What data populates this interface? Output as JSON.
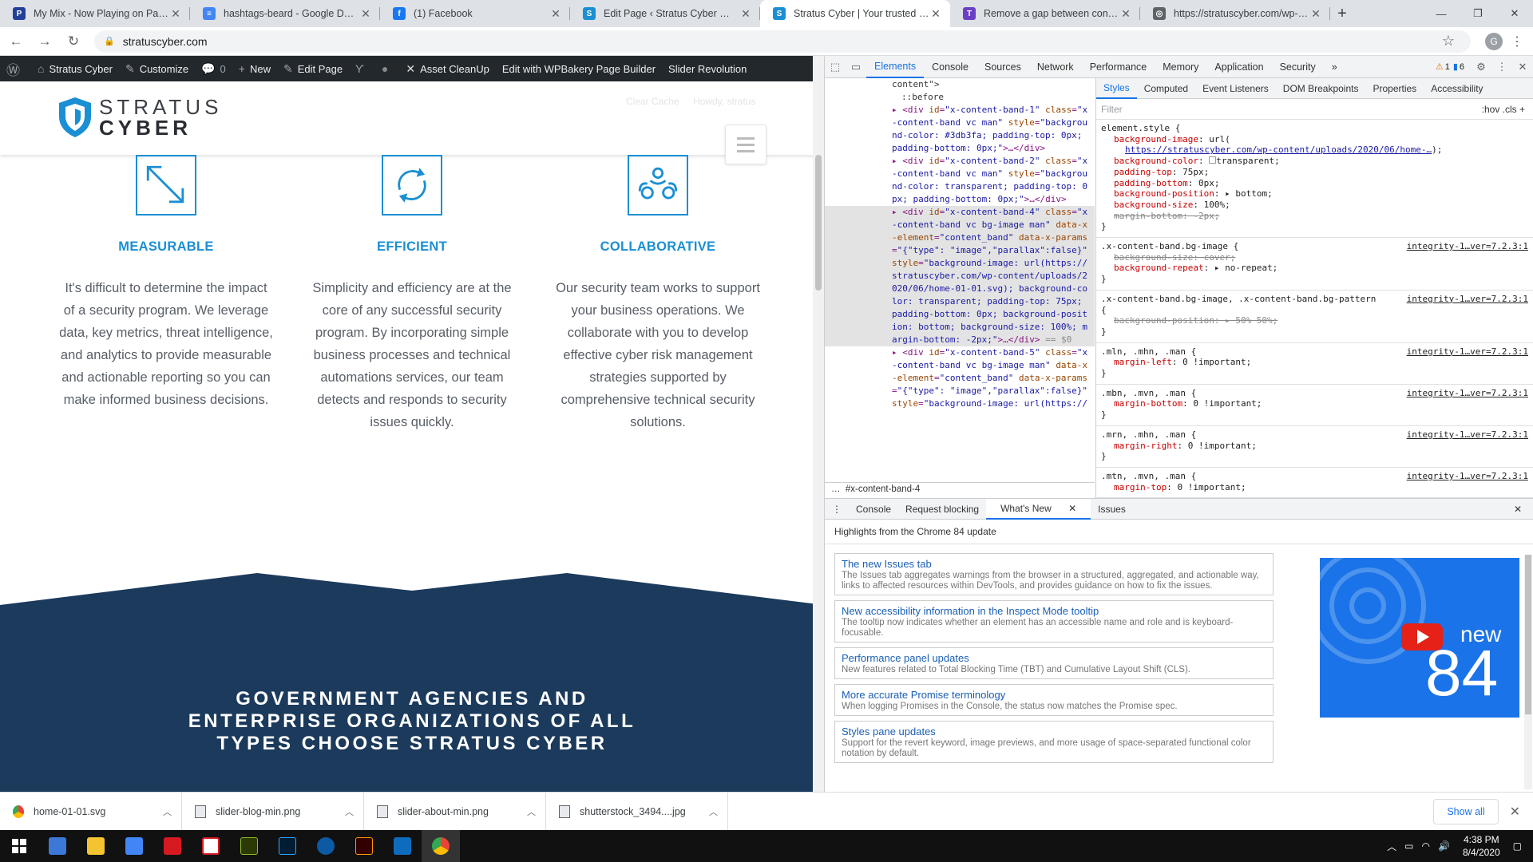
{
  "browser": {
    "tabs": [
      {
        "title": "My Mix - Now Playing on Pandora",
        "favicon_color": "#224099",
        "favicon_letter": "P"
      },
      {
        "title": "hashtags-beard - Google Docs",
        "favicon_color": "#4285f4",
        "favicon_letter": "≡"
      },
      {
        "title": "(1) Facebook",
        "favicon_color": "#1877f2",
        "favicon_letter": "f"
      },
      {
        "title": "Edit Page ‹ Stratus Cyber — WordPress",
        "favicon_color": "#1b8fd3",
        "favicon_letter": "S"
      },
      {
        "title": "Stratus Cyber | Your trusted enterprise",
        "favicon_color": "#1b8fd3",
        "favicon_letter": "S"
      },
      {
        "title": "Remove a gap between content band",
        "favicon_color": "#6a3fc6",
        "favicon_letter": "T"
      },
      {
        "title": "https://stratuscyber.com/wp-content",
        "favicon_color": "#5f6368",
        "favicon_letter": "◎"
      }
    ],
    "active_tab_index": 4,
    "url": "stratuscyber.com",
    "profile_letter": "G"
  },
  "wp_admin_bar": {
    "items": [
      "Stratus Cyber",
      "Customize",
      "0",
      "New",
      "Edit Page",
      "Asset CleanUp",
      "Edit with WPBakery Page Builder",
      "Slider Revolution"
    ],
    "ghost_links": [
      "Clear Cache",
      "Howdy, stratus"
    ]
  },
  "site": {
    "logo_top": "STRATUS",
    "logo_bottom": "CYBER",
    "features": [
      {
        "icon": "arrow-expand-icon",
        "title": "MEASURABLE",
        "text": "It's difficult to determine the impact of a security program. We leverage data, key metrics, threat intelligence, and analytics to provide measurable and actionable reporting so you can make informed business decisions."
      },
      {
        "icon": "refresh-cycle-icon",
        "title": "EFFICIENT",
        "text": "Simplicity and efficiency are at the core of any successful security program. By incorporating simple business processes and technical automations services, our team detects and responds to security issues quickly."
      },
      {
        "icon": "team-collaboration-icon",
        "title": "COLLABORATIVE",
        "text": "Our security team works to support your business operations. We collaborate with you to develop effective cyber risk management strategies supported by comprehensive technical security solutions."
      }
    ],
    "band_heading_lines": [
      "GOVERNMENT AGENCIES AND",
      "ENTERPRISE ORGANIZATIONS OF ALL",
      "TYPES CHOOSE STRATUS CYBER"
    ],
    "brand_color": "#1b8fd3",
    "band_color": "#1b3a5c"
  },
  "devtools": {
    "tabs": [
      "Elements",
      "Console",
      "Sources",
      "Network",
      "Performance",
      "Memory",
      "Application",
      "Security"
    ],
    "warnings": "1",
    "messages": "6",
    "breadcrumb": "#x-content-band-4",
    "style_tabs": [
      "Styles",
      "Computed",
      "Event Listeners",
      "DOM Breakpoints",
      "Properties",
      "Accessibility"
    ],
    "filter_placeholder": "Filter",
    "filter_toggles": ":hov  .cls  +",
    "drawer_tabs": [
      "Console",
      "Request blocking",
      "What's New",
      "Issues"
    ],
    "whats_new_heading": "Highlights from the Chrome 84 update",
    "whats_new": [
      {
        "title": "The new Issues tab",
        "desc": "The Issues tab aggregates warnings from the browser in a structured, aggregated, and actionable way, links to affected resources within DevTools, and provides guidance on how to fix the issues."
      },
      {
        "title": "New accessibility information in the Inspect Mode tooltip",
        "desc": "The tooltip now indicates whether an element has an accessible name and role and is keyboard-focusable."
      },
      {
        "title": "Performance panel updates",
        "desc": "New features related to Total Blocking Time (TBT) and Cumulative Layout Shift (CLS)."
      },
      {
        "title": "More accurate Promise terminology",
        "desc": "When logging Promises in the Console, the status now matches the Promise spec."
      },
      {
        "title": "Styles pane updates",
        "desc": "Support for the revert keyword, image previews, and more usage of space-separated functional color notation by default."
      }
    ],
    "promo_text": "new",
    "promo_number": "84"
  },
  "downloads": {
    "files": [
      "home-01-01.svg",
      "slider-blog-min.png",
      "slider-about-min.png",
      "shutterstock_3494....jpg"
    ],
    "show_all": "Show all"
  },
  "taskbar": {
    "time": "4:38 PM",
    "date": "8/4/2020"
  }
}
